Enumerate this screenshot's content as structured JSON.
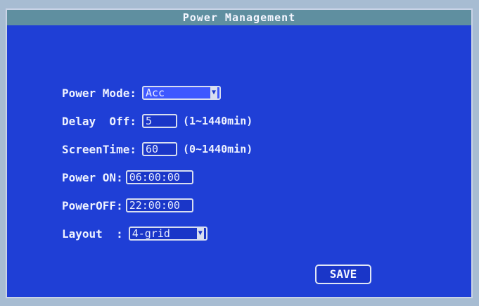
{
  "window": {
    "title": "Power Management"
  },
  "form": {
    "power_mode": {
      "label": "Power Mode:",
      "value": "Acc"
    },
    "delay_off": {
      "label": "Delay  Off:",
      "value": "5",
      "range": "(1~1440min)"
    },
    "screen_time": {
      "label": "ScreenTime:",
      "value": "60",
      "range": "(0~1440min)"
    },
    "power_on": {
      "label": "Power ON:",
      "value": "06:00:00"
    },
    "power_off": {
      "label": "PowerOFF:",
      "value": "22:00:00"
    },
    "layout": {
      "label": "Layout  :",
      "value": "4-grid"
    }
  },
  "buttons": {
    "save_label": "SAVE"
  },
  "colors": {
    "panel": "#1f3fd6",
    "titlebar": "#5f8fa0",
    "text": "#eef2ff"
  }
}
